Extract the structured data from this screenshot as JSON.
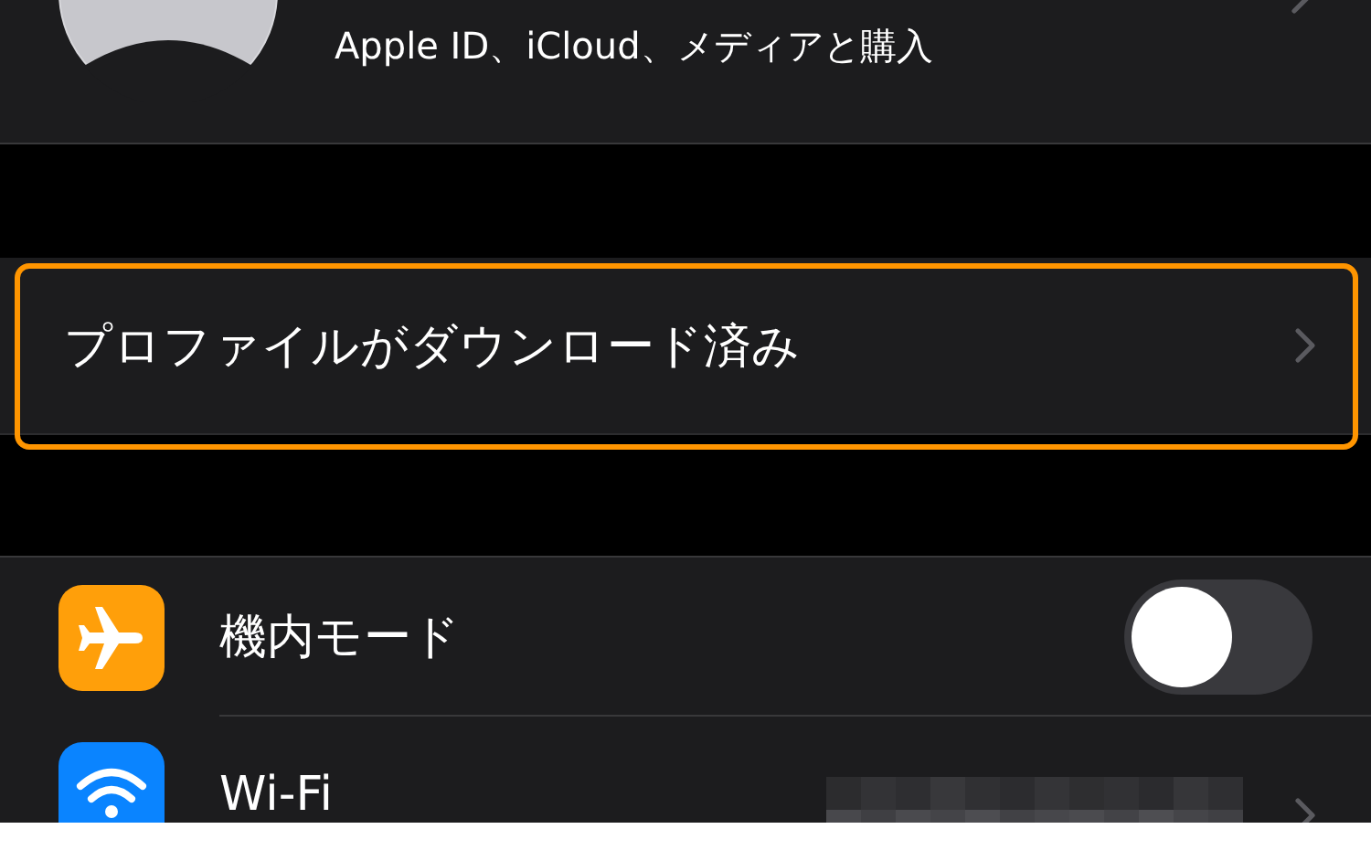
{
  "account": {
    "subtitle": "Apple ID、iCloud、メディアと購入"
  },
  "profile_row": {
    "label": "プロファイルがダウンロード済み",
    "highlighted": true
  },
  "settings": [
    {
      "kind": "toggle",
      "label": "機内モード",
      "on": false
    },
    {
      "kind": "link",
      "label": "Wi-Fi"
    }
  ]
}
